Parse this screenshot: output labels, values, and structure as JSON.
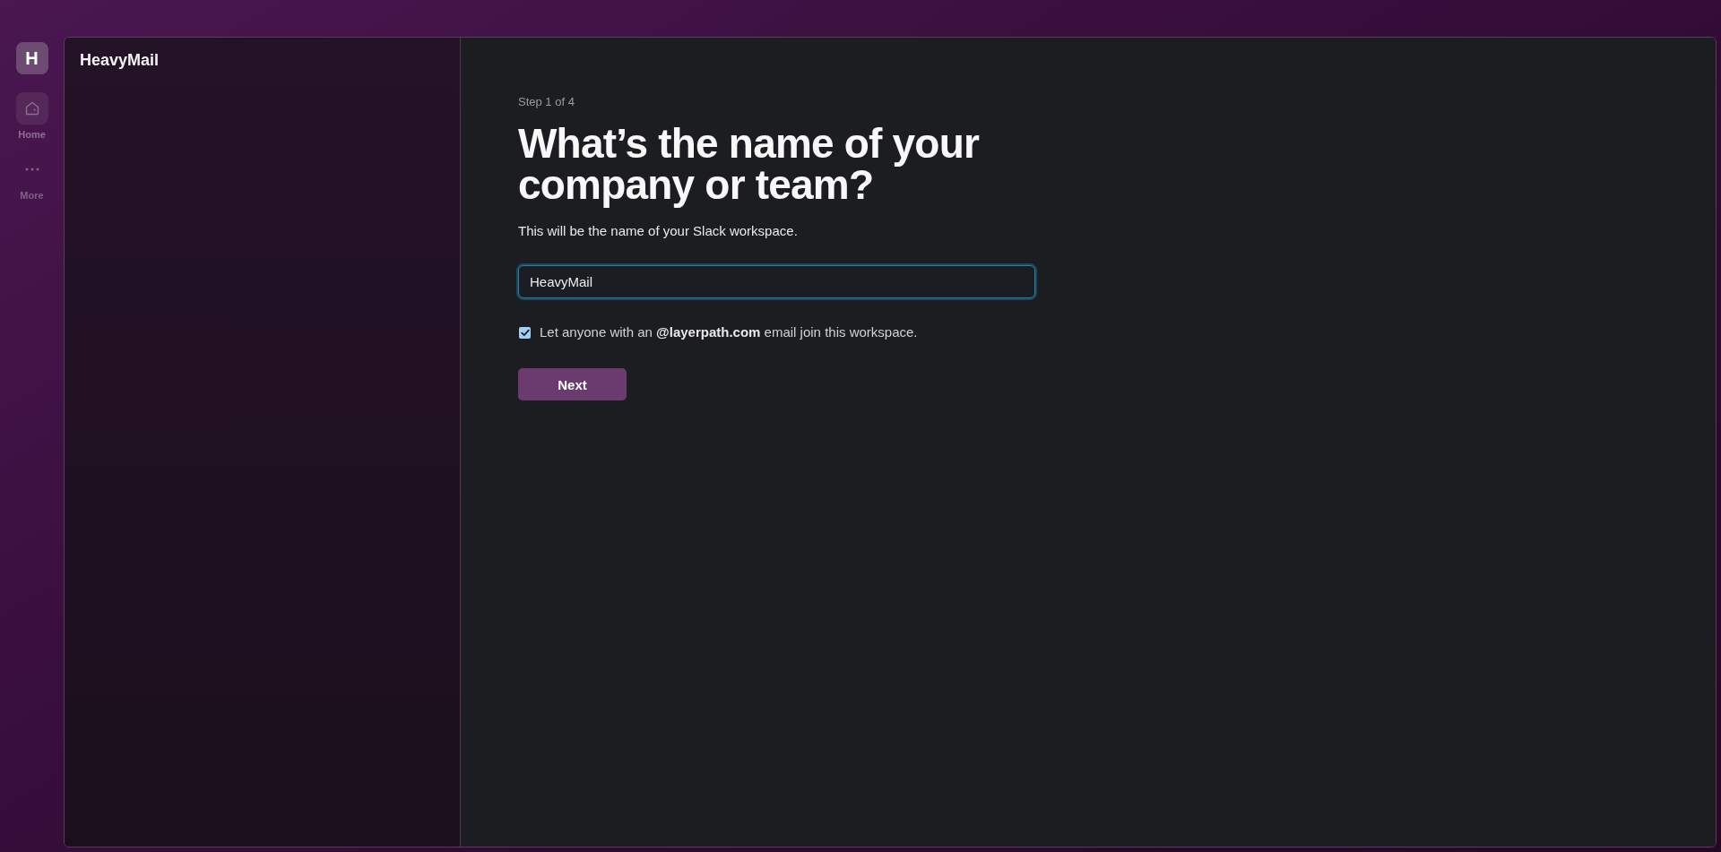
{
  "workspace": {
    "initial": "H"
  },
  "rail": [
    {
      "kind": "home",
      "label": "Home",
      "selected": true
    },
    {
      "kind": "more",
      "label": "More",
      "selected": false
    }
  ],
  "sidebar": {
    "title": "HeavyMail"
  },
  "form": {
    "step": "Step 1 of 4",
    "heading": "What’s the name of your company or team?",
    "subtitle": "This will be the name of your Slack workspace.",
    "name_field": {
      "value": "HeavyMail",
      "focused": true
    },
    "domain_option": {
      "label": "Let anyone with an **@layerpath.com** email join this workspace.",
      "checked": true
    },
    "next_button": {
      "label": "Next"
    }
  }
}
